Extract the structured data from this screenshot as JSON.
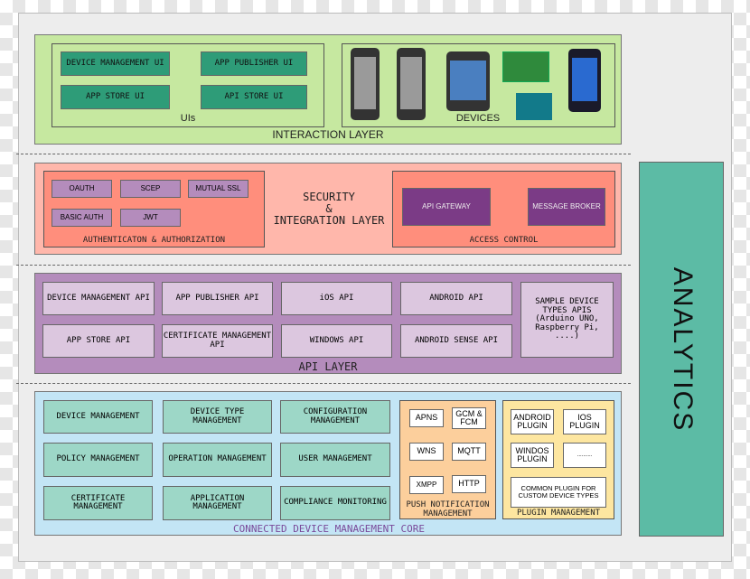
{
  "interaction": {
    "title": "INTERACTION LAYER",
    "uis_label": "UIs",
    "devices_label": "DEVICES",
    "uis": [
      "DEVICE MANAGEMENT UI",
      "APP PUBLISHER UI",
      "APP STORE UI",
      "API STORE UI"
    ]
  },
  "security": {
    "title_lines": [
      "SECURITY",
      "&",
      "INTEGRATION LAYER"
    ],
    "auth_label": "AUTHENTICATON & AUTHORIZATION",
    "auth_items": [
      "OAUTH",
      "SCEP",
      "MUTUAL SSL",
      "BASIC AUTH",
      "JWT"
    ],
    "access_label": "ACCESS CONTROL",
    "access_items": [
      "API GATEWAY",
      "MESSAGE BROKER"
    ]
  },
  "api": {
    "title": "API LAYER",
    "items": [
      "DEVICE MANAGEMENT API",
      "APP PUBLISHER API",
      "iOS API",
      "ANDROID API",
      "APP STORE API",
      "CERTIFICATE MANAGEMENT API",
      "WINDOWS API",
      "ANDROID SENSE API"
    ],
    "sample": "SAMPLE DEVICE TYPES APIS (Arduino UNO, Raspberry Pi, ....)"
  },
  "core": {
    "title": "CONNECTED DEVICE MANAGEMENT CORE",
    "items": [
      "DEVICE MANAGEMENT",
      "DEVICE TYPE MANAGEMENT",
      "CONFIGURATION MANAGEMENT",
      "POLICY MANAGEMENT",
      "OPERATION MANAGEMENT",
      "USER MANAGEMENT",
      "CERTIFICATE MANAGEMENT",
      "APPLICATION MANAGEMENT",
      "COMPLIANCE MONITORING"
    ],
    "push_label": "PUSH NOTIFICATION MANAGEMENT",
    "push_items": [
      "APNS",
      "GCM & FCM",
      "WNS",
      "MQTT",
      "XMPP",
      "HTTP"
    ],
    "plugin_label": "PLUGIN MANAGEMENT",
    "plugin_items": [
      "ANDROID PLUGIN",
      "IOS PLUGIN",
      "WINDOS PLUGIN",
      "..........",
      "COMMON PLUGIN FOR CUSTOM DEVICE TYPES"
    ]
  },
  "analytics": {
    "title": "ANALYTICS"
  },
  "colors": {
    "interaction": "#c6e8a0",
    "ui_box": "#2e9c78",
    "security": "#ffb7ab",
    "auth": "#ff8e7c",
    "auth_item": "#b48cbc",
    "access_item": "#7b3b86",
    "api": "#b48cbc",
    "api_item": "#dcc7df",
    "core": "#c3e5f5",
    "core_item": "#9dd7c7",
    "push": "#fccf9c",
    "plugin": "#fde6a0",
    "analytics": "#5cbba5"
  }
}
